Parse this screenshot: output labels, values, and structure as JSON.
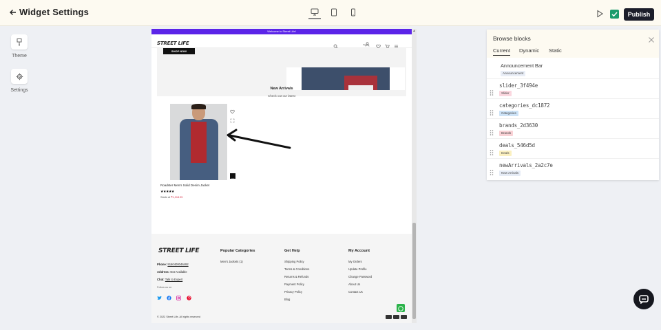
{
  "header": {
    "title": "Widget Settings",
    "publish_label": "Publish"
  },
  "sidebar": {
    "items": [
      {
        "label": "Theme",
        "icon": "palette-icon"
      },
      {
        "label": "Settings",
        "icon": "gear-icon"
      }
    ]
  },
  "preview": {
    "announcement": "Welcome to Street Life!",
    "logo": "STREET LIFE",
    "sign_in": "Sign In",
    "hero_button": "SHOP NOW",
    "section_title": "New Arrivals",
    "section_subtitle": "Check out our latest",
    "product": {
      "name": "Roadster Men's Solid Denim Jacket",
      "stars": "★★★★★",
      "price_prefix": "Starts at ",
      "price": "₹1,318.95"
    },
    "footer": {
      "logo": "STREET LIFE",
      "phone_label": "Phone:",
      "phone": "9160400046492",
      "address_label": "Address:",
      "address": "Not Available",
      "chat_label": "Chat:",
      "chat": "Talk to Expert",
      "follow": "Follow us on",
      "col1_title": "Popular Categories",
      "col1_links": [
        "Men's Jackets (1)"
      ],
      "col2_title": "Get Help",
      "col2_links": [
        "Shipping Policy",
        "Terms & Conditions",
        "Returns & Refunds",
        "Payment Policy",
        "Privacy Policy",
        "Blog"
      ],
      "col3_title": "My Account",
      "col3_links": [
        "My Orders",
        "Update Profile",
        "Change Password",
        "About Us",
        "Contact Us"
      ],
      "copyright": "© 2022 Street Life. All rights reserved"
    }
  },
  "panel": {
    "title": "Browse blocks",
    "tabs": [
      "Current",
      "Dynamic",
      "Static"
    ],
    "blocks": [
      {
        "name": "Announcement Bar",
        "badge": "Announcement",
        "badge_color": "#e9eef7",
        "draggable": false
      },
      {
        "name": "slider_3f494e",
        "badge": "Slider",
        "badge_color": "#fbd7df",
        "draggable": true
      },
      {
        "name": "categories_dc1872",
        "badge": "Categories",
        "badge_color": "#cde3f7",
        "draggable": true
      },
      {
        "name": "brands_2d3630",
        "badge": "Brands",
        "badge_color": "#f9d2d6",
        "draggable": true
      },
      {
        "name": "deals_546d5d",
        "badge": "Deals",
        "badge_color": "#fbf0c0",
        "draggable": true
      },
      {
        "name": "newArrivals_2a2c7e",
        "badge": "New Arrivals",
        "badge_color": "#e6ecf6",
        "draggable": true
      }
    ]
  },
  "colors": {
    "accent": "#5b24e8",
    "publish_bg": "#1c1e2b",
    "check": "#1a9c6c",
    "whatsapp": "#2bb34a"
  }
}
